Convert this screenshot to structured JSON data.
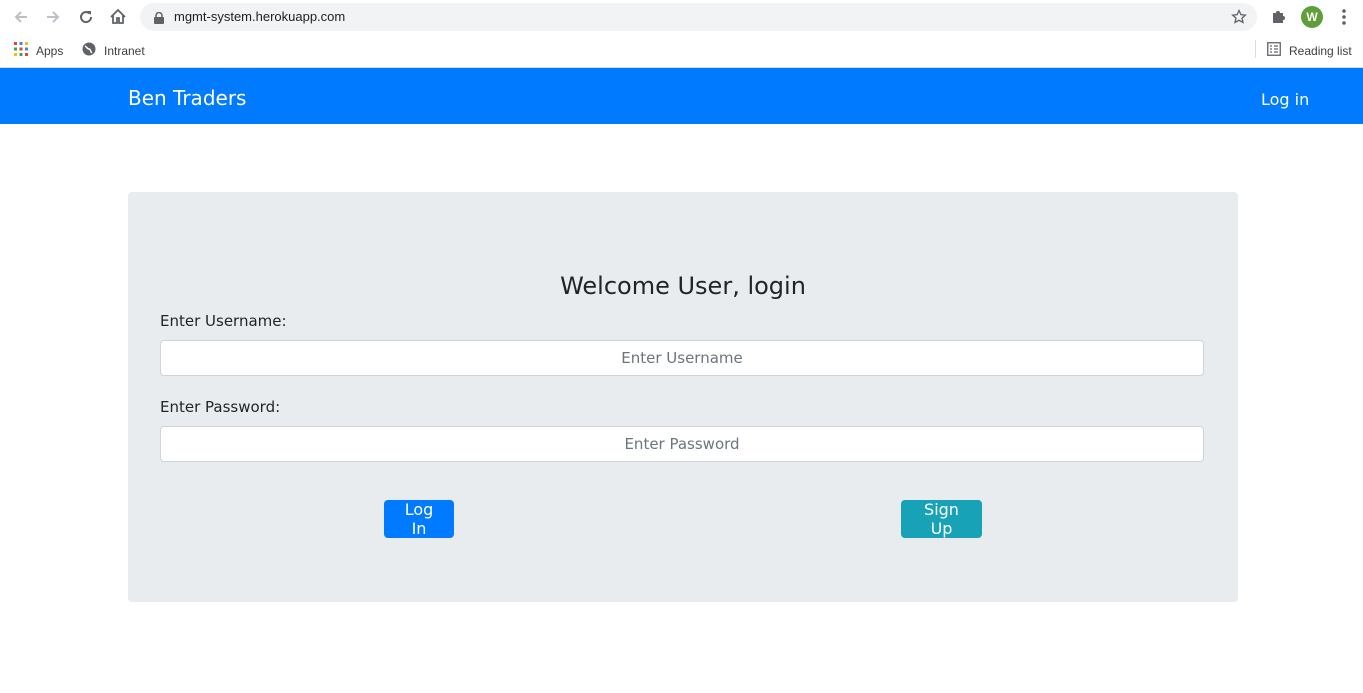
{
  "browser": {
    "url": "mgmt-system.herokuapp.com",
    "avatar_letter": "W",
    "bookmarks": {
      "apps": "Apps",
      "intranet": "Intranet",
      "reading_list": "Reading list"
    }
  },
  "navbar": {
    "brand": "Ben Traders",
    "login_link": "Log in",
    "color": "#007bff"
  },
  "login_card": {
    "title": "Welcome User, login",
    "username_label": "Enter Username:",
    "username_placeholder": "Enter Username",
    "username_value": "",
    "password_label": "Enter Password:",
    "password_placeholder": "Enter Password",
    "password_value": "",
    "login_button": "Log In",
    "signup_button": "Sign Up",
    "login_button_color": "#007bff",
    "signup_button_color": "#17a2b8"
  },
  "icons": {
    "back": "back-arrow-icon",
    "forward": "forward-arrow-icon",
    "reload": "reload-icon",
    "home": "home-icon",
    "lock": "lock-icon",
    "star": "star-icon",
    "extensions": "puzzle-icon",
    "menu": "kebab-menu-icon",
    "apps": "apps-grid-icon",
    "intranet": "globe-icon",
    "reading_list": "reading-list-icon"
  }
}
